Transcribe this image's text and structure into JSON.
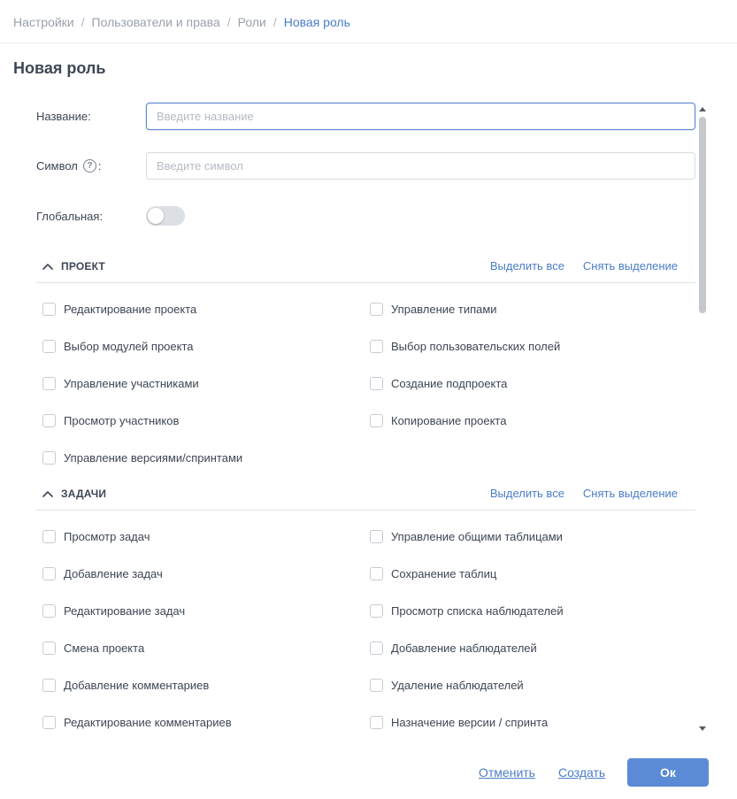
{
  "breadcrumb": [
    "Настройки",
    "Пользователи и права",
    "Роли",
    "Новая роль"
  ],
  "page_title": "Новая роль",
  "form": {
    "name_label": "Название:",
    "name_placeholder": "Введите название",
    "name_value": "",
    "symbol_label": "Символ",
    "symbol_colon": ":",
    "symbol_help": "?",
    "symbol_placeholder": "Введите символ",
    "symbol_value": "",
    "global_label": "Глобальная:",
    "global_on": false
  },
  "sections": [
    {
      "title": "ПРОЕКТ",
      "select_all": "Выделить все",
      "deselect": "Снять выделение",
      "left": [
        "Редактирование проекта",
        "Выбор модулей проекта",
        "Управление участниками",
        "Просмотр участников",
        "Управление версиями/спринтами"
      ],
      "right": [
        "Управление типами",
        "Выбор пользовательских полей",
        "Создание подпроекта",
        "Копирование проекта"
      ]
    },
    {
      "title": "ЗАДАЧИ",
      "select_all": "Выделить все",
      "deselect": "Снять выделение",
      "left": [
        "Просмотр задач",
        "Добавление задач",
        "Редактирование задач",
        "Смена проекта",
        "Добавление комментариев",
        "Редактирование комментариев"
      ],
      "right": [
        "Управление общими таблицами",
        "Сохранение таблиц",
        "Просмотр списка наблюдателей",
        "Добавление наблюдателей",
        "Удаление наблюдателей",
        "Назначение версии / спринта"
      ]
    }
  ],
  "footer": {
    "cancel": "Отменить",
    "create": "Создать",
    "ok": "Ок"
  },
  "colors": {
    "accent": "#4a7dc9",
    "button": "#5b8ad6",
    "text": "#3d4654",
    "muted": "#9aa1ab"
  }
}
